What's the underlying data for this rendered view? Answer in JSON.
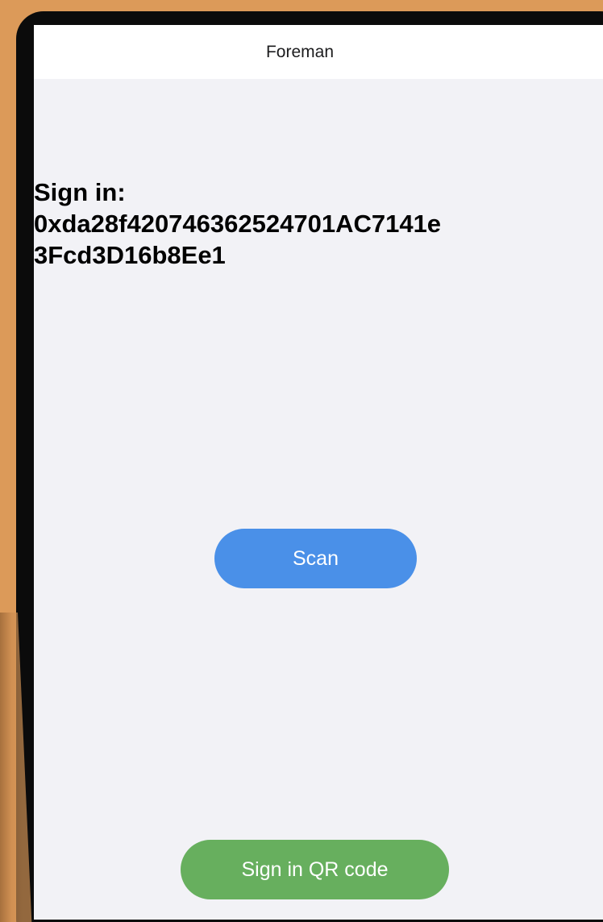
{
  "nav": {
    "title": "Foreman"
  },
  "sign_in": {
    "label": "Sign in:",
    "address_line1": "0xda28f420746362524701AC7141e",
    "address_line2": "3Fcd3D16b8Ee1"
  },
  "buttons": {
    "scan_label": "Scan",
    "qr_label": "Sign in QR code"
  },
  "colors": {
    "background_wood": "#DC9A59",
    "screen_bg": "#F2F2F6",
    "scan_button": "#4A90E8",
    "qr_button": "#67AF5E"
  }
}
